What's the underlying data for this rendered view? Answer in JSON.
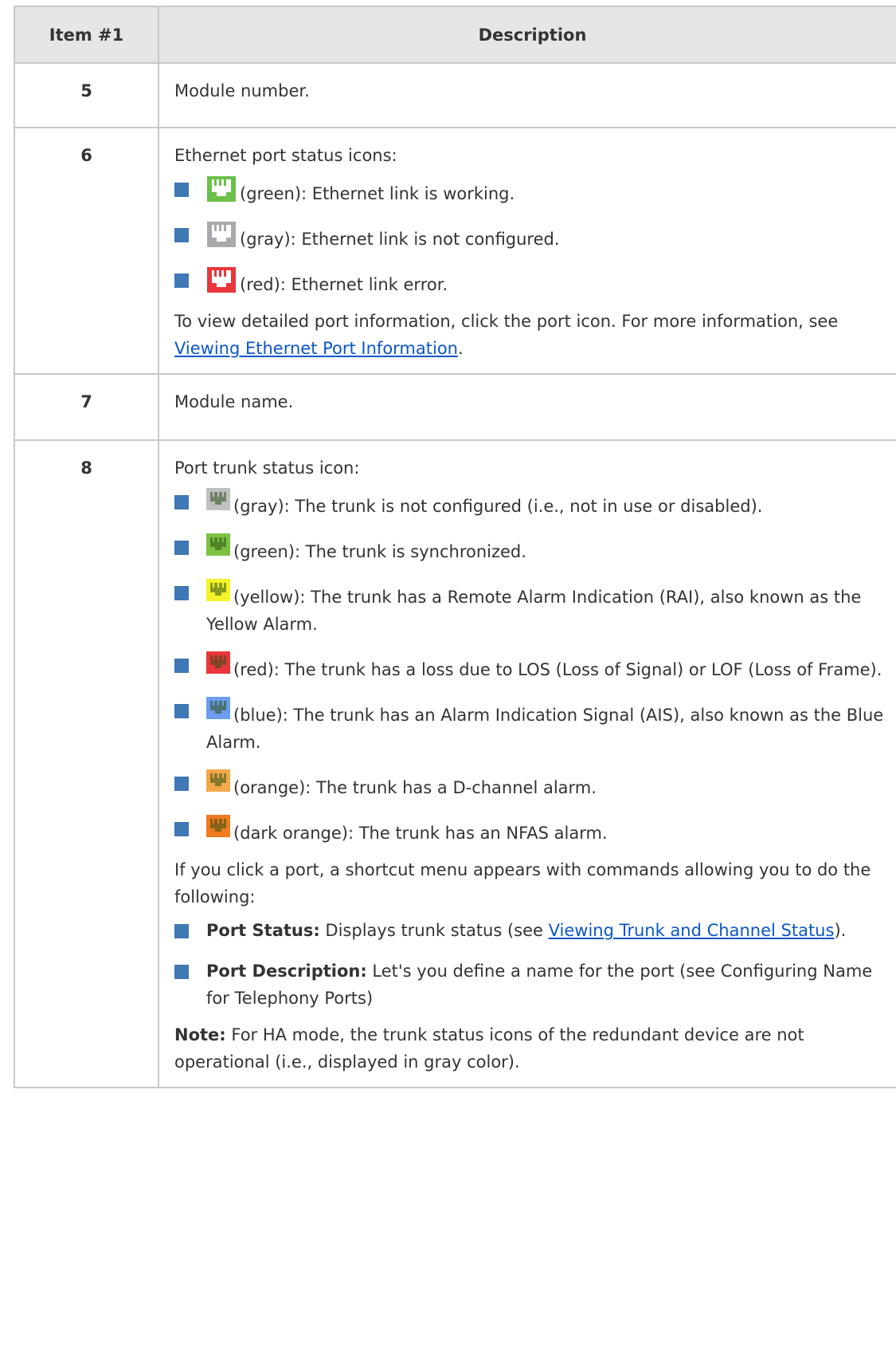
{
  "header": {
    "col_item": "Item #1",
    "col_desc": "Description"
  },
  "rows": {
    "r5": {
      "item": "5",
      "desc": "Module number."
    },
    "r6": {
      "item": "6",
      "intro": "Ethernet port status icons:",
      "icons": [
        {
          "icon": "ethernet-port-green-icon",
          "color": "#6cc04a",
          "text": "(green): Ethernet link is working."
        },
        {
          "icon": "ethernet-port-gray-icon",
          "color": "#a7a9ac",
          "text": "(gray): Ethernet link is not configured."
        },
        {
          "icon": "ethernet-port-red-icon",
          "color": "#e8363b",
          "text": "(red): Ethernet link error."
        }
      ],
      "note_prefix": "To view detailed port information, click the port icon. For more information, see ",
      "note_link": "Viewing Ethernet Port Information",
      "note_suffix": "."
    },
    "r7": {
      "item": "7",
      "desc": "Module name."
    },
    "r8": {
      "item": "8",
      "intro": "Port trunk status icon:",
      "icons": [
        {
          "icon": "trunk-gray-icon",
          "color": "#c0c0c0",
          "text": "(gray): The trunk is not configured (i.e., not in use or disabled)."
        },
        {
          "icon": "trunk-green-icon",
          "color": "#7cc242",
          "text": "(green): The trunk is synchronized."
        },
        {
          "icon": "trunk-yellow-icon",
          "color": "#f3f32a",
          "text": "(yellow): The trunk has a Remote Alarm Indication (RAI), also known as the Yellow Alarm."
        },
        {
          "icon": "trunk-red-icon",
          "color": "#e8363b",
          "text": "(red): The trunk has a loss due to LOS (Loss of Signal) or LOF (Loss of Frame)."
        },
        {
          "icon": "trunk-blue-icon",
          "color": "#6b9cf0",
          "text": "(blue): The trunk has an Alarm Indication Signal (AIS), also known as the Blue Alarm."
        },
        {
          "icon": "trunk-orange-icon",
          "color": "#f2a94a",
          "text": "(orange): The trunk has a D-channel alarm."
        },
        {
          "icon": "trunk-dark-orange-icon",
          "color": "#f07a1e",
          "text": "(dark orange): The trunk has an NFAS alarm."
        }
      ],
      "menu_intro": "If you click a port, a shortcut menu appears with commands allowing you to do the following:",
      "commands": {
        "status_label": "Port Status:",
        "status_text": " Displays trunk status (see ",
        "status_link": "Viewing Trunk and Channel Status",
        "status_end": ").",
        "desc_label": "Port Description:",
        "desc_text": " Let's you define a name for the port (see Configuring Name for Telephony Ports)"
      },
      "note_label": "Note:",
      "note_text": " For HA mode, the trunk status icons of the redundant device are not operational (i.e., displayed in gray color)."
    }
  },
  "colors": {
    "bullet": "#3f78b5",
    "link": "#0a56c9",
    "header_bg": "#e6e6e6",
    "border": "#c8c8c8"
  }
}
